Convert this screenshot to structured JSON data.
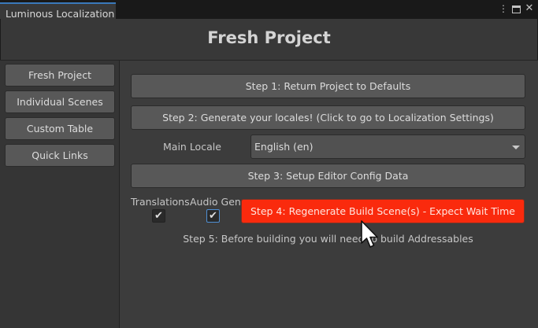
{
  "window": {
    "tab_title": "Luminous Localization",
    "menu_icon": "kebab-menu-icon",
    "maximize_icon": "maximize-icon",
    "close_icon": "close-icon"
  },
  "title": "Fresh Project",
  "sidebar": {
    "items": [
      {
        "label": "Fresh Project"
      },
      {
        "label": "Individual Scenes"
      },
      {
        "label": "Custom Table"
      },
      {
        "label": "Quick Links"
      }
    ]
  },
  "main": {
    "step1_label": "Step 1: Return Project to Defaults",
    "step2_label": "Step 2: Generate your locales! (Click to go to Localization Settings)",
    "main_locale_label": "Main Locale",
    "main_locale_value": "English (en)",
    "step3_label": "Step 3: Setup Editor Config Data",
    "translations_label": "Translations",
    "translations_checked": true,
    "audio_gen_label": "Audio Gen",
    "audio_gen_checked": true,
    "step4_label": "Step 4: Regenerate Build Scene(s) - Expect Wait Time",
    "step5_text": "Step 5: Before building you will need to build Addressables"
  },
  "colors": {
    "accent": "#3a79bb",
    "step4_button": "#fa2a0d"
  },
  "cursor_icon": "mouse-pointer-icon"
}
